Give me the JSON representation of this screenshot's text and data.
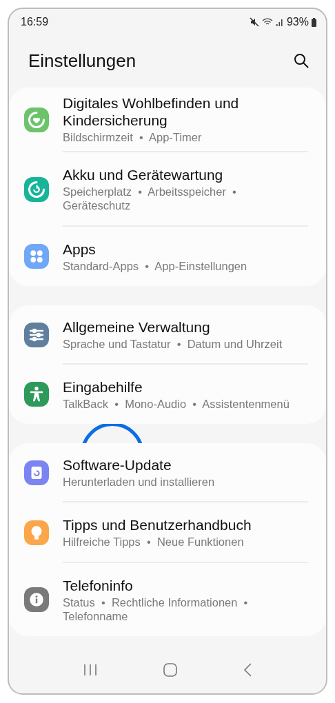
{
  "status_bar": {
    "time": "16:59",
    "battery": "93%"
  },
  "header": {
    "title": "Einstellungen"
  },
  "groups": [
    {
      "items": [
        {
          "color": "#6cc36a",
          "title": "Digitales Wohlbefinden und Kindersicherung",
          "subtitle": "Bildschirmzeit  •  App-Timer"
        },
        {
          "color": "#17b49a",
          "title": "Akku und Gerätewartung",
          "subtitle": "Speicherplatz  •  Arbeitsspeicher  •  Geräteschutz"
        },
        {
          "color": "#6ea8f7",
          "title": "Apps",
          "subtitle": "Standard-Apps  •  App-Einstellungen"
        }
      ]
    },
    {
      "items": [
        {
          "color": "#5f7f9c",
          "title": "Allgemeine Verwaltung",
          "subtitle": "Sprache und Tastatur  •  Datum und Uhrzeit"
        },
        {
          "color": "#2e9a5a",
          "title": "Eingabehilfe",
          "subtitle": "TalkBack  •  Mono-Audio  •  Assistentenmenü"
        }
      ]
    },
    {
      "items": [
        {
          "color": "#7c84f2",
          "title": "Software-Update",
          "subtitle": "Herunterladen und installieren"
        },
        {
          "color": "#fba64a",
          "title": "Tipps und Benutzerhandbuch",
          "subtitle": "Hilfreiche Tipps  •  Neue Funktionen"
        },
        {
          "color": "#7a7a7a",
          "title": "Telefoninfo",
          "subtitle": "Status  •  Rechtliche Informationen  •  Telefonname"
        }
      ]
    }
  ]
}
